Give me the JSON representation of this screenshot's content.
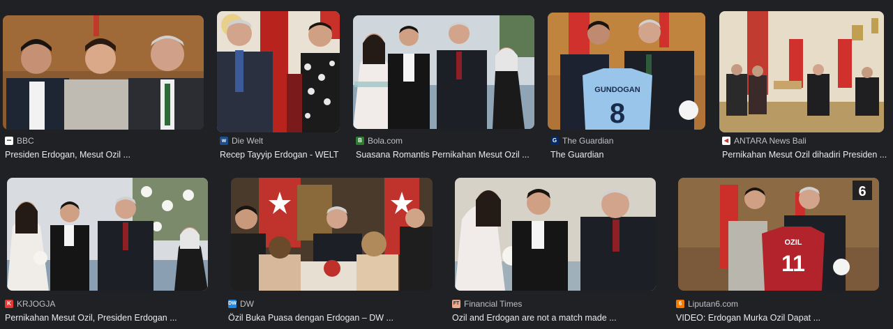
{
  "results": [
    {
      "source": "BBC",
      "title": "Presiden Erdogan, Mesut Ozil ...",
      "favicon": "bbc-icon",
      "favicon_color": "#ffffff"
    },
    {
      "source": "Die Welt",
      "title": "Recep Tayyip Erdogan - WELT",
      "favicon": "welt-icon",
      "favicon_color": "#1e4d8c"
    },
    {
      "source": "Bola.com",
      "title": "Suasana Romantis Pernikahan Mesut Ozil ...",
      "favicon": "bola-icon",
      "favicon_color": "#2e7d32"
    },
    {
      "source": "The Guardian",
      "title": "The Guardian",
      "favicon": "guardian-icon",
      "favicon_color": "#052962"
    },
    {
      "source": "ANTARA News Bali",
      "title": "Pernikahan Mesut Ozil dihadiri Presiden ...",
      "favicon": "antara-icon",
      "favicon_color": "#d32f2f"
    },
    {
      "source": "KRJOGJA",
      "title": "Pernikahan Mesut Ozil, Presiden Erdogan ...",
      "favicon": "krjogja-icon",
      "favicon_color": "#e53935"
    },
    {
      "source": "DW",
      "title": "Özil Buka Puasa dengan Erdogan – DW ...",
      "favicon": "dw-icon",
      "favicon_color": "#1e88e5"
    },
    {
      "source": "Financial Times",
      "title": "Ozil and Erdogan are not a match made ...",
      "favicon": "ft-icon",
      "favicon_color": "#f2a88a"
    },
    {
      "source": "Liputan6.com",
      "title": "VIDEO: Erdogan Murka Ozil Dapat ...",
      "favicon": "liputan6-icon",
      "favicon_color": "#f57c00"
    }
  ],
  "jersey": {
    "name": "GUNDOGAN",
    "number": "8",
    "number2": "11",
    "name2": "OZIL"
  },
  "watermark": "6"
}
